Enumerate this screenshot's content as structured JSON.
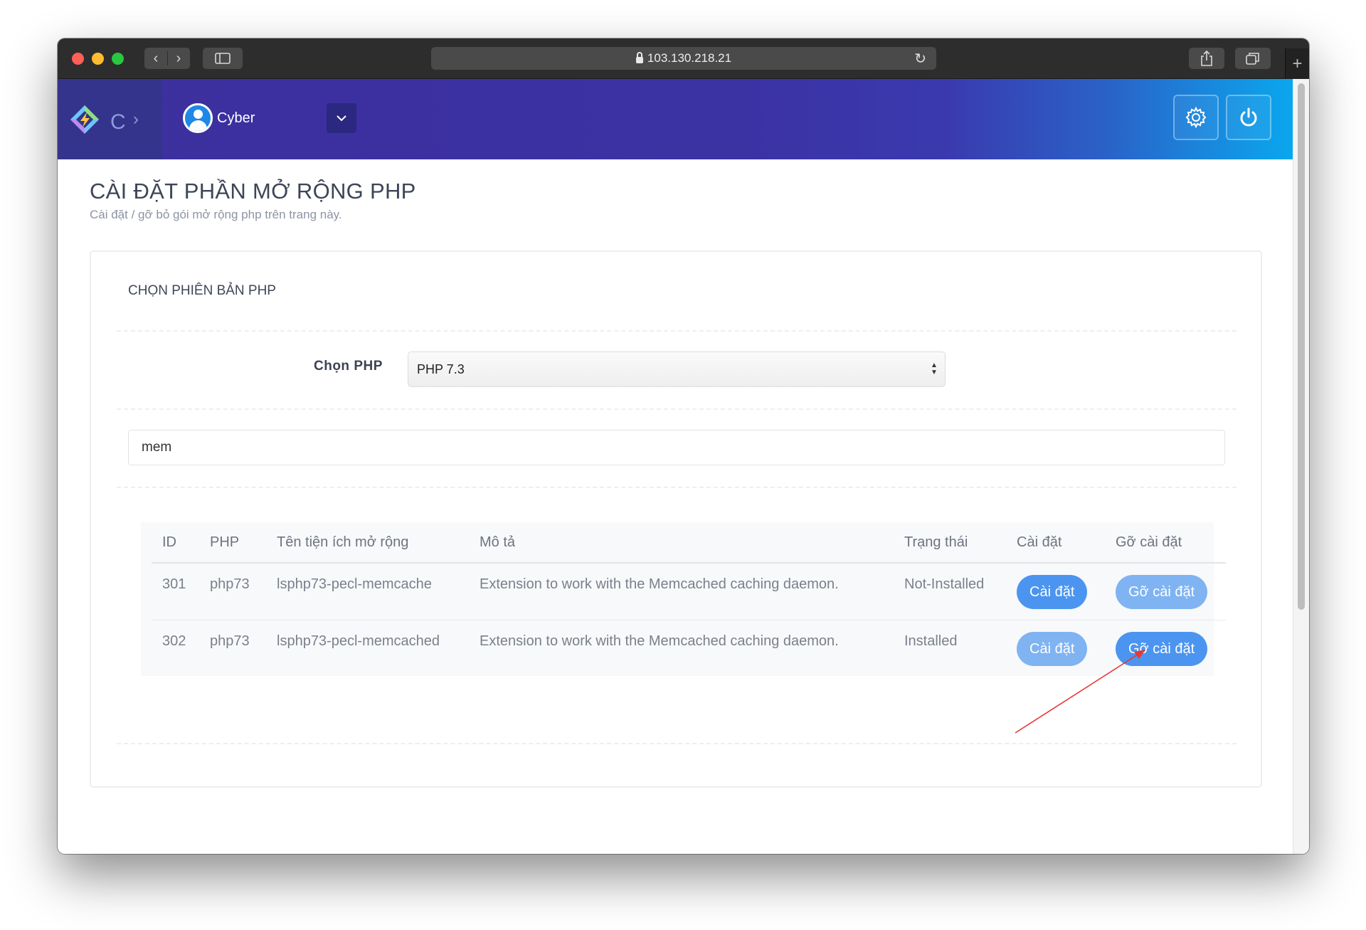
{
  "browser": {
    "url": "103.130.218.21"
  },
  "header": {
    "brand_letter": "C",
    "user_name": "Cyber"
  },
  "page": {
    "title": "CÀI ĐẶT PHẦN MỞ RỘNG PHP",
    "subtitle": "Cài đặt / gỡ bỏ gói mở rộng php trên trang này."
  },
  "panel": {
    "title": "CHỌN PHIÊN BẢN PHP",
    "php_label": "Chọn PHP",
    "php_selected": "PHP 7.3",
    "search_value": "mem"
  },
  "table": {
    "headers": [
      "ID",
      "PHP",
      "Tên tiện ích mở rộng",
      "Mô tả",
      "Trạng thái",
      "Cài đặt",
      "Gỡ cài đặt"
    ],
    "rows": [
      {
        "id": "301",
        "php": "php73",
        "name": "lsphp73-pecl-memcache",
        "description": "Extension to work with the Memcached caching daemon.",
        "status": "Not-Installed",
        "install_label": "Cài đặt",
        "uninstall_label": "Gỡ cài đặt"
      },
      {
        "id": "302",
        "php": "php73",
        "name": "lsphp73-pecl-memcached",
        "description": "Extension to work with the Memcached caching daemon.",
        "status": "Installed",
        "install_label": "Cài đặt",
        "uninstall_label": "Gỡ cài đặt"
      }
    ]
  },
  "colors": {
    "button_active": "#4b95f0",
    "button_disabled": "#7fb3f2",
    "annotation_arrow": "#e53935"
  }
}
